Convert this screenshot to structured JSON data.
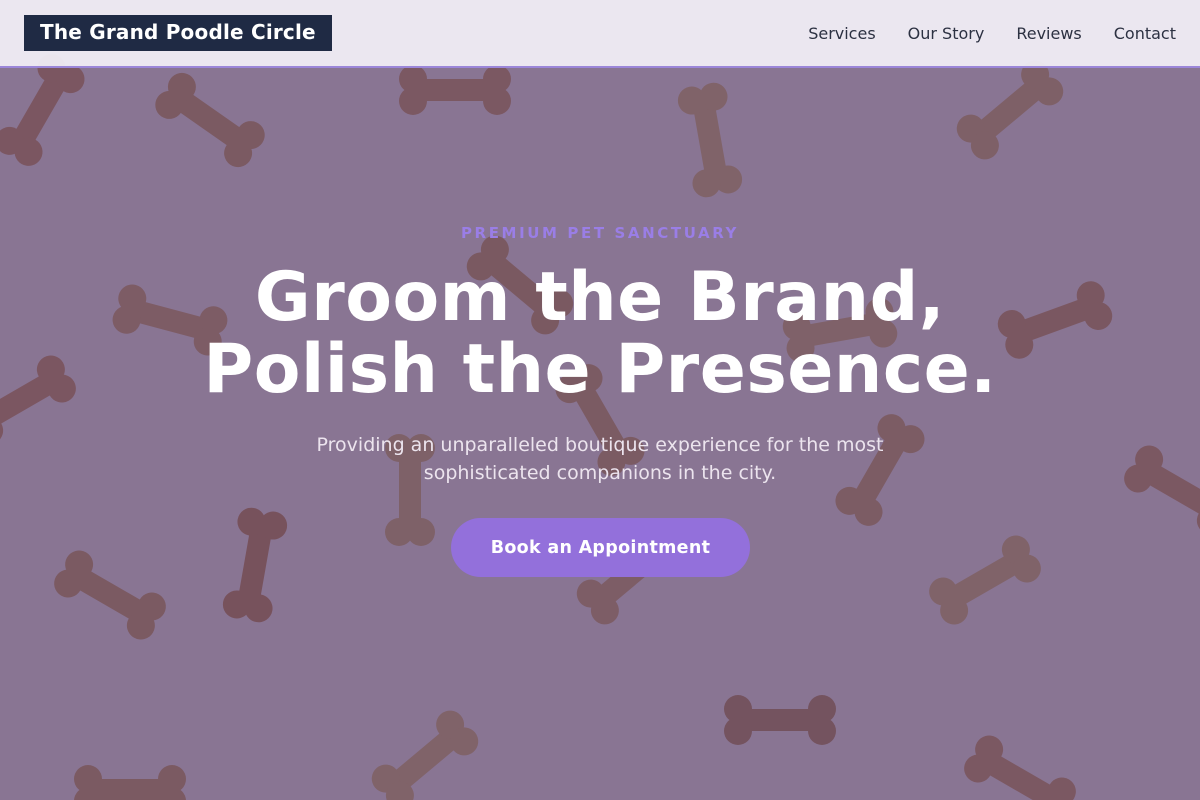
{
  "header": {
    "logo": "The Grand Poodle Circle",
    "nav": [
      "Services",
      "Our Story",
      "Reviews",
      "Contact"
    ]
  },
  "hero": {
    "eyebrow": "PREMIUM PET SANCTUARY",
    "headline_line1": "Groom the Brand,",
    "headline_line2": "Polish the Presence.",
    "subtitle": "Providing an unparalleled boutique experience for the most sophisticated companions in the city.",
    "cta_label": "Book an Appointment",
    "background_image": "dog-bone-biscuits-pattern"
  },
  "colors": {
    "accent": "#9370db",
    "logo_background": "#1f2a44",
    "overlay": "#3e2e5c",
    "header_border": "#9b86d9"
  }
}
